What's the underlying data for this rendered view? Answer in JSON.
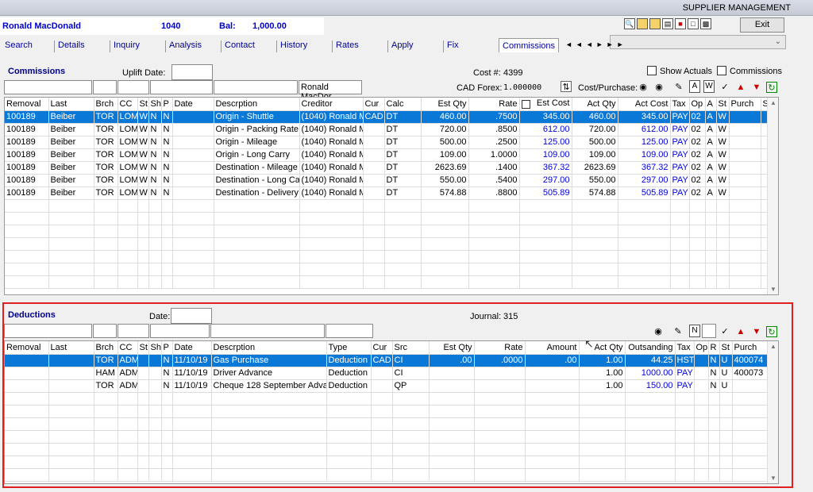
{
  "app_title": "SUPPLIER MANAGEMENT",
  "header": {
    "name": "Ronald MacDonald",
    "account": "1040",
    "bal_label": "Bal:",
    "bal_value": "1,000.00"
  },
  "exit_label": "Exit",
  "tabs": [
    "Search",
    "Details",
    "Inquiry",
    "Analysis",
    "Contact",
    "History",
    "Rates",
    "Apply",
    "Fix",
    "Commissions"
  ],
  "commissions": {
    "title": "Commissions",
    "uplift_label": "Uplift Date:",
    "cost_label": "Cost #:",
    "cost_value": "4399",
    "forex_label": "CAD Forex:",
    "forex_value": "1.000000",
    "cost_purchase_label": "Cost/Purchase:",
    "show_actuals_label": "Show Actuals",
    "commissions_check_label": "Commissions",
    "creditor_filter": "Ronald MacDor",
    "btn_a": "A",
    "btn_w": "W",
    "columns": [
      "Removal",
      "Last",
      "Brch",
      "CC",
      "St",
      "Sh",
      "P",
      "Date",
      "Descrption",
      "Creditor",
      "Cur",
      "Calc",
      "Est Qty",
      "Rate",
      "Est Cost",
      "Act Qty",
      "Act Cost",
      "Tax",
      "Op",
      "A",
      "St",
      "Purch",
      "S"
    ],
    "rows": [
      [
        "100189",
        "Beiber",
        "TOR",
        "LOM",
        "W",
        "N",
        "N",
        "",
        "Origin - Shuttle",
        "(1040) Ronald M",
        "CAD",
        "DT",
        "460.00",
        ".7500",
        "345.00",
        "460.00",
        "345.00",
        "PAY",
        "02",
        "A",
        "W",
        "",
        ""
      ],
      [
        "100189",
        "Beiber",
        "TOR",
        "LOM",
        "W",
        "N",
        "N",
        "",
        "Origin - Packing Rate",
        "(1040) Ronald M",
        "",
        "DT",
        "720.00",
        ".8500",
        "612.00",
        "720.00",
        "612.00",
        "PAY",
        "02",
        "A",
        "W",
        "",
        ""
      ],
      [
        "100189",
        "Beiber",
        "TOR",
        "LOM",
        "W",
        "N",
        "N",
        "",
        "Origin - Mileage",
        "(1040) Ronald M",
        "",
        "DT",
        "500.00",
        ".2500",
        "125.00",
        "500.00",
        "125.00",
        "PAY",
        "02",
        "A",
        "W",
        "",
        ""
      ],
      [
        "100189",
        "Beiber",
        "TOR",
        "LOM",
        "W",
        "N",
        "N",
        "",
        "Origin - Long Carry",
        "(1040) Ronald M",
        "",
        "DT",
        "109.00",
        "1.0000",
        "109.00",
        "109.00",
        "109.00",
        "PAY",
        "02",
        "A",
        "W",
        "",
        ""
      ],
      [
        "100189",
        "Beiber",
        "TOR",
        "LOM",
        "W",
        "N",
        "N",
        "",
        "Destination - Mileage",
        "(1040) Ronald M",
        "",
        "DT",
        "2623.69",
        ".1400",
        "367.32",
        "2623.69",
        "367.32",
        "PAY",
        "02",
        "A",
        "W",
        "",
        ""
      ],
      [
        "100189",
        "Beiber",
        "TOR",
        "LOM",
        "W",
        "N",
        "N",
        "",
        "Destination - Long Carr",
        "(1040) Ronald M",
        "",
        "DT",
        "550.00",
        ".5400",
        "297.00",
        "550.00",
        "297.00",
        "PAY",
        "02",
        "A",
        "W",
        "",
        ""
      ],
      [
        "100189",
        "Beiber",
        "TOR",
        "LOM",
        "W",
        "N",
        "N",
        "",
        "Destination - Delivery F",
        "(1040) Ronald M",
        "",
        "DT",
        "574.88",
        ".8800",
        "505.89",
        "574.88",
        "505.89",
        "PAY",
        "02",
        "A",
        "W",
        "",
        ""
      ]
    ]
  },
  "deductions": {
    "title": "Deductions",
    "date_label": "Date:",
    "journal_label": "Journal:",
    "journal_value": "315",
    "btn_n": "N",
    "columns": [
      "Removal",
      "Last",
      "Brch",
      "CC",
      "St",
      "Sh",
      "P",
      "Date",
      "Descrption",
      "Type",
      "Cur",
      "Src",
      "Est Qty",
      "Rate",
      "Amount",
      "Act Qty",
      "Outsanding",
      "Tax",
      "Op",
      "R",
      "St",
      "Purch",
      "S"
    ],
    "rows": [
      [
        "",
        "",
        "TOR",
        "ADM",
        "",
        "",
        "N",
        "11/10/19",
        "Gas Purchase",
        "Deduction",
        "CAD",
        "CI",
        ".00",
        ".0000",
        ".00",
        "1.00",
        "44.25",
        "HST",
        "",
        "N",
        "U",
        "400074",
        ""
      ],
      [
        "",
        "",
        "HAM",
        "ADM",
        "",
        "",
        "N",
        "11/10/19",
        "Driver Advance",
        "Deduction",
        "",
        "CI",
        "",
        "",
        "",
        "1.00",
        "1000.00",
        "PAY",
        "",
        "N",
        "U",
        "400073",
        ""
      ],
      [
        "",
        "",
        "TOR",
        "ADM",
        "",
        "",
        "N",
        "11/10/19",
        "Cheque 128 September Advan",
        "Deduction",
        "",
        "QP",
        "",
        "",
        "",
        "1.00",
        "150.00",
        "PAY",
        "",
        "N",
        "U",
        "",
        ""
      ]
    ]
  }
}
